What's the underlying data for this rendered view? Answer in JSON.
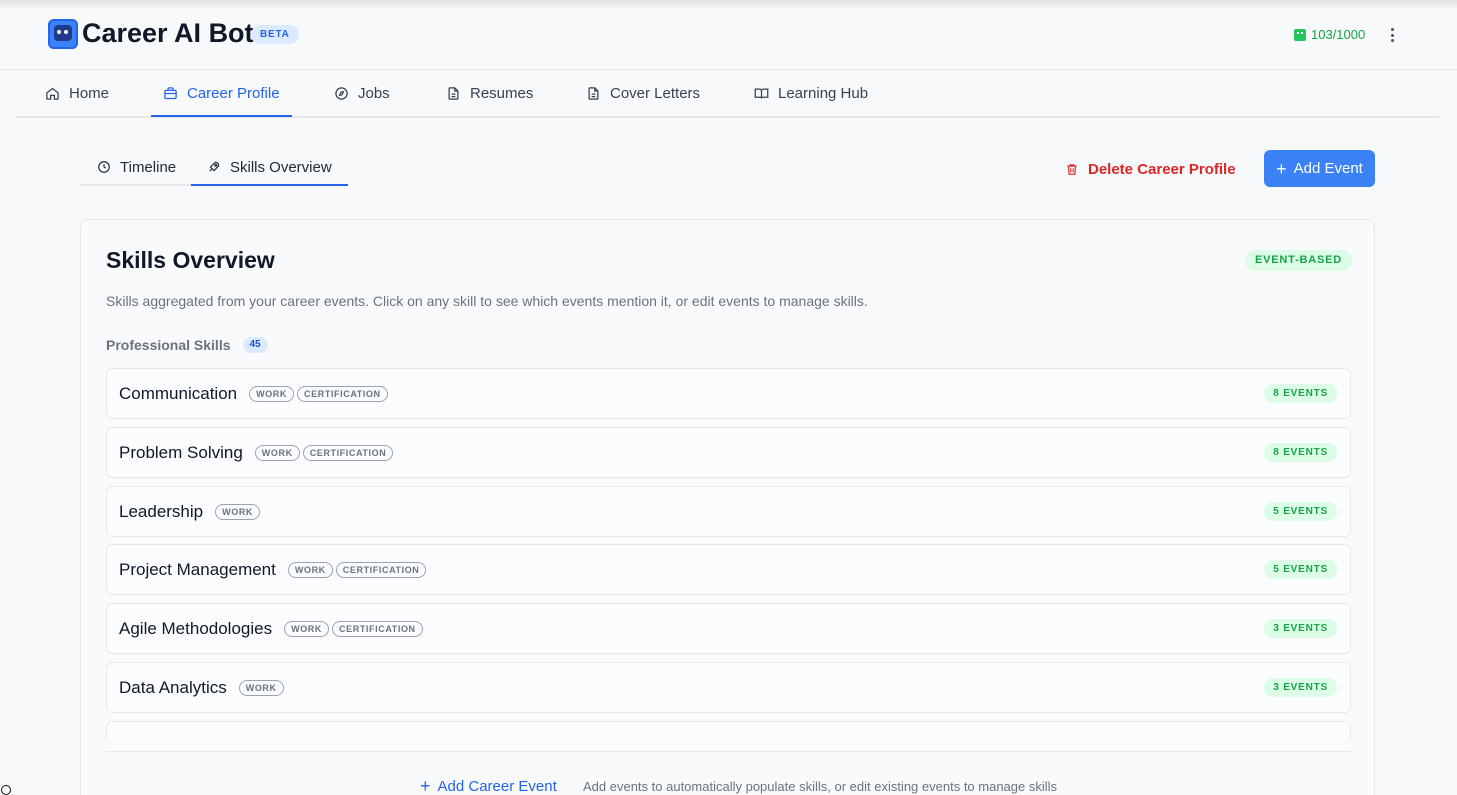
{
  "app": {
    "title": "Career AI Bot",
    "badge": "BETA",
    "credits": "103/1000",
    "accent": "#3b82f6"
  },
  "nav": {
    "tabs": [
      {
        "label": "Home",
        "icon": "home-icon"
      },
      {
        "label": "Career Profile",
        "icon": "briefcase-icon",
        "active": true
      },
      {
        "label": "Jobs",
        "icon": "compass-icon"
      },
      {
        "label": "Resumes",
        "icon": "document-icon"
      },
      {
        "label": "Cover Letters",
        "icon": "document-icon"
      },
      {
        "label": "Learning Hub",
        "icon": "book-icon"
      }
    ]
  },
  "subtabs": [
    {
      "label": "Timeline",
      "icon": "clock-icon"
    },
    {
      "label": "Skills Overview",
      "icon": "rocket-icon",
      "active": true
    }
  ],
  "actions": {
    "delete_label": "Delete Career Profile",
    "add_label": "Add Event"
  },
  "skills_card": {
    "title": "Skills Overview",
    "badge": "EVENT-BASED",
    "description": "Skills aggregated from your career events. Click on any skill to see which events mention it, or edit events to manage skills.",
    "section_label": "Professional Skills",
    "section_count": "45",
    "skills": [
      {
        "name": "Communication",
        "tags": [
          "WORK",
          "CERTIFICATION"
        ],
        "events": "8 EVENTS"
      },
      {
        "name": "Problem Solving",
        "tags": [
          "WORK",
          "CERTIFICATION"
        ],
        "events": "8 EVENTS"
      },
      {
        "name": "Leadership",
        "tags": [
          "WORK"
        ],
        "events": "5 EVENTS"
      },
      {
        "name": "Project Management",
        "tags": [
          "WORK",
          "CERTIFICATION"
        ],
        "events": "5 EVENTS"
      },
      {
        "name": "Agile Methodologies",
        "tags": [
          "WORK",
          "CERTIFICATION"
        ],
        "events": "3 EVENTS"
      },
      {
        "name": "Data Analytics",
        "tags": [
          "WORK"
        ],
        "events": "3 EVENTS"
      }
    ],
    "footer_action": "Add Career Event",
    "footer_hint": "Add events to automatically populate skills, or edit existing events to manage skills"
  }
}
